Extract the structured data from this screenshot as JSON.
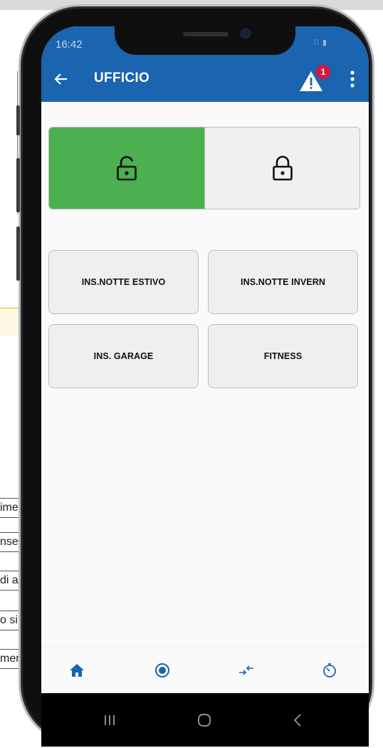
{
  "status_bar": {
    "time": "16:42",
    "icons": "⁞⁞ ▮"
  },
  "app_bar": {
    "title": "UFFICIO",
    "alert_count": "1"
  },
  "lock_panel": {
    "disarm_label": "",
    "arm_label": ""
  },
  "scenarios": [
    {
      "label": "INS.NOTTE ESTIVO"
    },
    {
      "label": "INS.NOTTE INVERN"
    },
    {
      "label": "INS. GARAGE"
    },
    {
      "label": "FITNESS"
    }
  ],
  "background_cells": [
    "ime",
    "nse",
    "di a",
    "o si",
    "mer"
  ],
  "colors": {
    "app_bar": "#1a64b0",
    "disarmed": "#4caf50",
    "badge": "#d0193e",
    "active_nav": "#1a64b0"
  }
}
